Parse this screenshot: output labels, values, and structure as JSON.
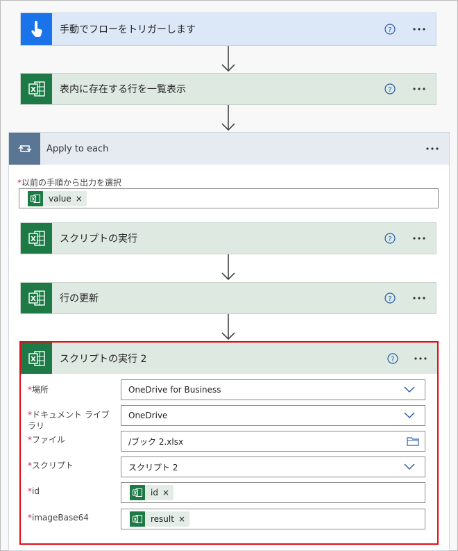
{
  "trigger": {
    "title": "手動でフローをトリガーします",
    "icon": "touch-icon"
  },
  "list_rows": {
    "title": "表内に存在する行を一覧表示",
    "icon": "excel-icon"
  },
  "apply_each": {
    "title": "Apply to each",
    "select_label": "以前の手順から出力を選択",
    "token": "value"
  },
  "run_script_1": {
    "title": "スクリプトの実行"
  },
  "update_row": {
    "title": "行の更新"
  },
  "run_script_2": {
    "title": "スクリプトの実行 2",
    "fields": [
      {
        "label": "場所",
        "value": "OneDrive for Business",
        "kind": "dropdown"
      },
      {
        "label": "ドキュメント ライブラリ",
        "value": "OneDrive",
        "kind": "dropdown"
      },
      {
        "label": "ファイル",
        "value": "/ブック 2.xlsx",
        "kind": "file"
      },
      {
        "label": "スクリプト",
        "value": "スクリプト 2",
        "kind": "dropdown"
      },
      {
        "label": "id",
        "value": "id",
        "kind": "token"
      },
      {
        "label": "imageBase64",
        "value": "result",
        "kind": "token"
      }
    ]
  },
  "required_mark": "*",
  "token_close": "×",
  "colors": {
    "excel": "#1d7a46",
    "trigger": "#1a73e8",
    "highlight": "#e30a17",
    "loop": "#5b7695"
  }
}
